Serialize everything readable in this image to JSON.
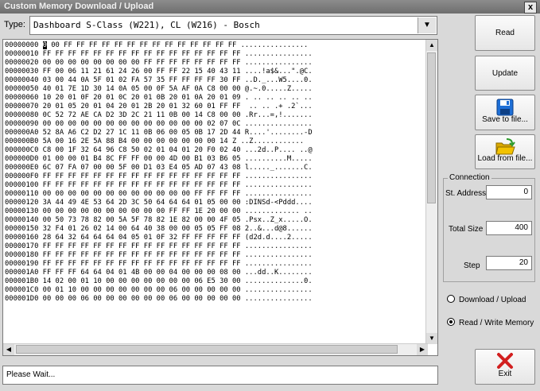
{
  "window": {
    "title": "Custom Memory Download / Upload",
    "close_glyph": "x"
  },
  "type": {
    "label": "Type:",
    "value": "Dashboard S-Class (W221), CL (W216) - Bosch"
  },
  "hex": {
    "caret_char": "0",
    "lines": [
      "00000000 0 00 FF FF FF FF FF FF FF FF FF FF FF FF FF FF ................",
      "00000010 FF FF FF FF FF FF FF FF FF FF FF FF FF FF FF FF ................",
      "00000020 00 00 00 00 00 00 00 00 FF FF FF FF FF FF FF FF ................",
      "00000030 FF 00 06 11 21 61 24 26 00 FF FF 22 15 40 43 11 ....!a$&...\".@C.",
      "00000040 03 00 44 0A 5F 01 02 FA 57 35 FF FF FF FF 30 FF ..D._...W5....0.",
      "00000050 40 01 7E 1D 30 14 0A 05 00 0F 5A AF 0A C8 00 00 @.~.0.....Z.....",
      "00000060 10 20 01 0F 20 01 0C 20 01 0B 20 01 0A 20 01 09 . .. .. .. .. ..",
      "00000070 20 01 05 20 01 04 20 01 2B 20 01 32 60 01 FF FF  .. .. .+ .2`...",
      "00000080 0C 52 72 AE CA D2 3D 2C 21 11 0B 00 14 C8 00 00 .Rr...=,!.......",
      "00000090 00 00 00 00 00 00 00 00 00 00 00 00 00 02 07 0C ................",
      "000000A0 52 8A A6 C2 D2 27 1C 11 0B 06 00 05 0B 17 2D 44 R....'........-D",
      "000000B0 5A 00 16 2E 5A 88 B4 00 00 00 00 00 00 00 14 Z ..Z............",
      "000000C0 C8 00 1F 32 64 96 C8 50 02 01 04 01 20 F0 02 40 ...2d..P.... ..@",
      "000000D0 01 00 00 01 B4 8C FF FF 00 00 4D 00 B1 03 B6 05 ..........M.....",
      "000000E0 6C 07 FA 07 00 00 5F 00 D1 03 E4 05 AD 07 43 08 l....._.......C.",
      "000000F0 FF FF FF FF FF FF FF FF FF FF FF FF FF FF FF FF ................",
      "00000100 FF FF FF FF FF FF FF FF FF FF FF FF FF FF FF FF ................",
      "00000110 00 00 00 00 00 00 00 00 00 00 00 00 FF FF FF FF ................",
      "00000120 3A 44 49 4E 53 64 2D 3C 50 64 64 64 01 05 00 00 :DINSd-<Pddd....",
      "00000130 00 00 00 00 00 00 00 00 00 00 FF FF 1E 20 00 00 ............. ..",
      "00000140 00 50 73 78 82 00 5A 5F 78 82 1E 82 00 00 4F 05 .Psx..Z_x.....O.",
      "00000150 32 F4 01 26 02 14 00 64 40 38 00 00 05 05 FF 08 2..&...d@8......",
      "00000160 28 64 32 64 64 64 04 05 01 0F 32 FF FF FF FF FF (d2d.d....2.....",
      "00000170 FF FF FF FF FF FF FF FF FF FF FF FF FF FF FF FF ................",
      "00000180 FF FF FF FF FF FF FF FF FF FF FF FF FF FF FF FF ................",
      "00000190 FF FF FF FF FF FF FF FF FF FF FF FF FF FF FF FF ................",
      "000001A0 FF FF FF 64 64 04 01 4B 00 00 04 00 00 00 08 00 ...dd..K........",
      "000001B0 14 02 00 01 10 00 00 00 00 00 00 00 06 E5 30 00 ..............0.",
      "000001C0 00 01 10 00 00 00 00 00 00 00 06 00 00 00 00 00 ................",
      "000001D0 00 00 00 06 00 00 00 00 00 00 06 00 00 00 00 00 ................"
    ]
  },
  "status": {
    "text": "Please Wait..."
  },
  "buttons": {
    "read": "Read",
    "update": "Update",
    "save": "Save to file...",
    "load": "Load from file...",
    "exit": "Exit"
  },
  "connection": {
    "legend": "Connection",
    "start_label": "St. Address",
    "start_value": "0",
    "total_label": "Total Size",
    "total_value": "400",
    "step_label": "Step",
    "step_value": "20"
  },
  "mode": {
    "download_upload": "Download / Upload",
    "read_write": "Read / Write Memory",
    "selected": "read_write"
  },
  "colors": {
    "save_icon": "#1e6fd6",
    "load_icon": "#f2c200",
    "exit_icon": "#d21f1f"
  }
}
